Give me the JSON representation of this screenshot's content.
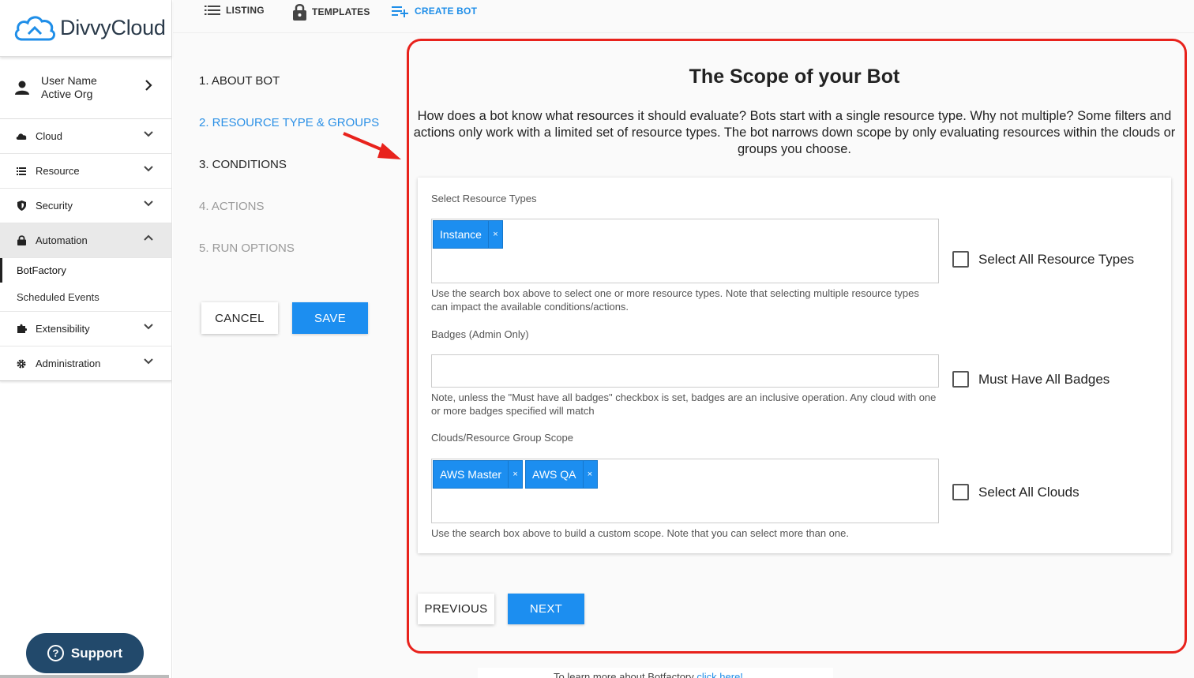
{
  "brand": {
    "name": "DivvyCloud"
  },
  "user": {
    "name": "User Name",
    "org": "Active Org"
  },
  "sidebar": {
    "items": [
      {
        "label": "Cloud"
      },
      {
        "label": "Resource"
      },
      {
        "label": "Security"
      },
      {
        "label": "Automation"
      },
      {
        "label": "Extensibility"
      },
      {
        "label": "Administration"
      }
    ],
    "automation_subitems": [
      {
        "label": "BotFactory"
      },
      {
        "label": "Scheduled Events"
      }
    ]
  },
  "support": {
    "label": "Support"
  },
  "tabs": {
    "listing": "LISTING",
    "templates": "TEMPLATES",
    "create_bot": "CREATE BOT"
  },
  "steps": [
    {
      "label": "1. ABOUT BOT"
    },
    {
      "label": "2. RESOURCE TYPE & GROUPS"
    },
    {
      "label": "3. CONDITIONS"
    },
    {
      "label": "4. ACTIONS"
    },
    {
      "label": "5. RUN OPTIONS"
    }
  ],
  "actions": {
    "cancel": "CANCEL",
    "save": "SAVE",
    "previous": "PREVIOUS",
    "next": "NEXT"
  },
  "panel": {
    "title": "The Scope of your Bot",
    "description": "How does a bot know what resources it should evaluate? Bots start with a single resource type. Why not multiple? Some filters and actions only work with a limited set of resource types. The bot narrows down scope by only evaluating resources within the clouds or groups you choose."
  },
  "fields": {
    "resource_types": {
      "label": "Select Resource Types",
      "tags": [
        "Instance"
      ],
      "help": "Use the search box above to select one or more resource types. Note that selecting multiple resource types can impact the available conditions/actions.",
      "checkbox": "Select All Resource Types"
    },
    "badges": {
      "label": "Badges (Admin Only)",
      "value": "",
      "help": "Note, unless the \"Must have all badges\" checkbox is set, badges are an inclusive operation. Any cloud with one or more badges specified will match",
      "checkbox": "Must Have All Badges"
    },
    "scope": {
      "label": "Clouds/Resource Group Scope",
      "tags": [
        "AWS Master",
        "AWS QA"
      ],
      "help": "Use the search box above to build a custom scope. Note that you can select more than one.",
      "checkbox": "Select All Clouds"
    },
    "tag_remove": "×"
  },
  "footer": {
    "text": "To learn more about Botfactory",
    "link": "click here!"
  },
  "colors": {
    "accent": "#1c8ef0",
    "highlight": "#e8221c",
    "support_bg": "#22496b"
  }
}
